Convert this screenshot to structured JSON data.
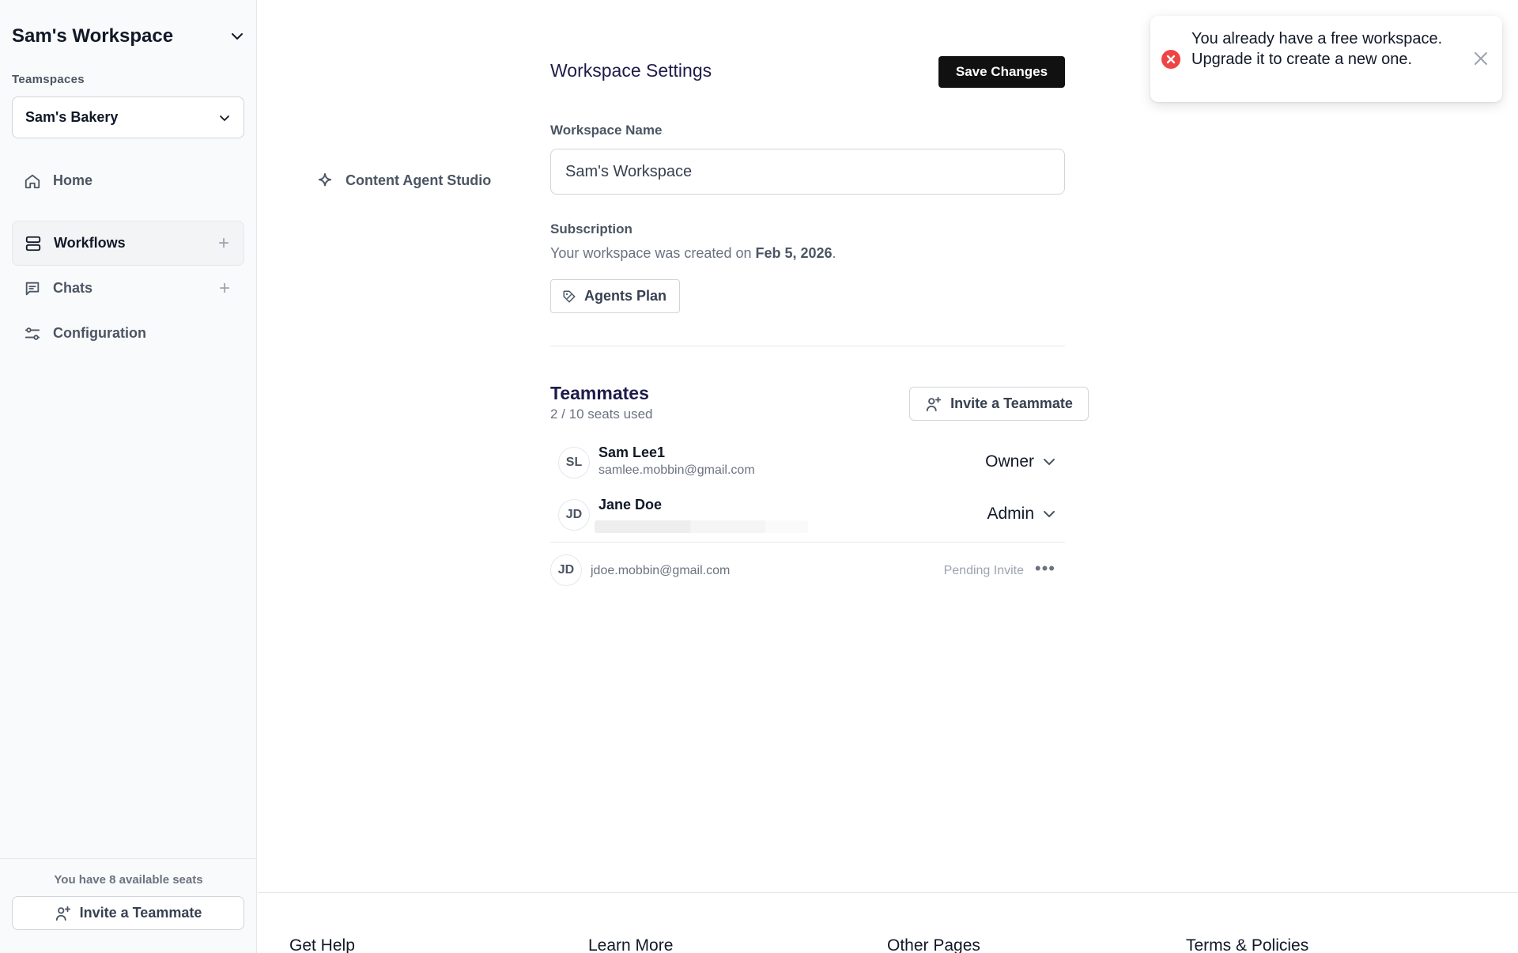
{
  "sidebar": {
    "workspace_title": "Sam's Workspace",
    "teamspaces_label": "Teamspaces",
    "selected_teamspace": "Sam's Bakery",
    "nav": [
      {
        "label": "Home",
        "icon": "home-icon"
      },
      {
        "label": "Content Agent Studio",
        "icon": "sparkle-icon"
      },
      {
        "label": "Workflows",
        "icon": "workflows-icon",
        "active": true,
        "has_add": true
      },
      {
        "label": "Chats",
        "icon": "chat-icon",
        "has_add": true
      },
      {
        "label": "Configuration",
        "icon": "sliders-icon"
      }
    ],
    "available_seats_text": "You have 8 available seats",
    "invite_label": "Invite a Teammate"
  },
  "settings": {
    "title": "Workspace Settings",
    "save_label": "Save Changes",
    "workspace_name_label": "Workspace Name",
    "workspace_name_value": "Sam's Workspace",
    "subscription_label": "Subscription",
    "created_prefix": "Your workspace was created on ",
    "created_date": "Feb 5, 2026",
    "created_suffix": ".",
    "plan_label": "Agents Plan"
  },
  "teammates": {
    "title": "Teammates",
    "seats_used": "2 / 10 seats used",
    "invite_label": "Invite a Teammate",
    "members": [
      {
        "initials": "SL",
        "name": "Sam Lee1",
        "email": "samlee.mobbin@gmail.com",
        "role": "Owner"
      },
      {
        "initials": "JD",
        "name": "Jane Doe",
        "email": "",
        "role": "Admin"
      }
    ],
    "pending": {
      "initials": "JD",
      "email": "jdoe.mobbin@gmail.com",
      "status": "Pending Invite"
    }
  },
  "footer": {
    "columns": [
      "Get Help",
      "Learn More",
      "Other Pages",
      "Terms & Policies"
    ]
  },
  "toast": {
    "message": "You already have a free workspace. Upgrade it to create a new one.",
    "type": "error",
    "icon_color": "#ef4444"
  },
  "colors": {
    "primary_button": "#111111",
    "heading": "#1e1b4b",
    "error": "#ef4444"
  }
}
